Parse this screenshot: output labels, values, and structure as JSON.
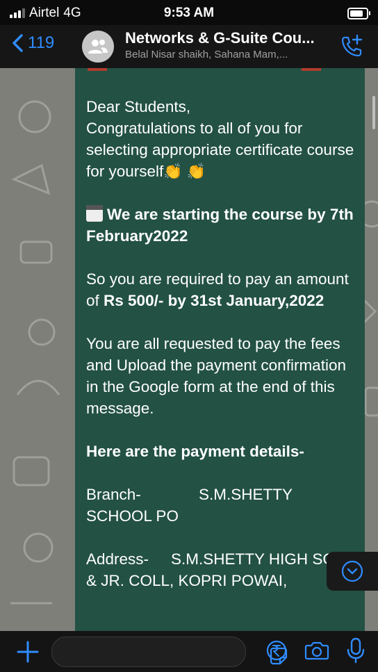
{
  "status_bar": {
    "carrier": "Airtel",
    "network": "4G",
    "time": "9:53 AM"
  },
  "header": {
    "back_count": "119",
    "title": "Networks & G-Suite Cou...",
    "subtitle": "Belal Nisar shaikh, Sahana Mam,..."
  },
  "message": {
    "greeting": "Dear Students,",
    "congrats": "Congratulations to all of you for selecting appropriate certificate course for yourself",
    "start": "We are starting the course by 7th February2022",
    "pay_prefix": "So you are required to pay an amount of ",
    "pay_amount": "Rs 500/- by 31st January,2022",
    "upload": "You are all requested to pay the fees and Upload the payment confirmation in the Google form at the end of this message.",
    "payment_heading": "Here are the payment details-",
    "branch_label": "Branch-",
    "branch_value": "S.M.SHETTY",
    "branch_value2": "SCHOOL PO",
    "address_label": "Address-",
    "address_value": "S.M.SHETTY HIGH SCH",
    "address_value2": "& JR. COLL, KOPRI POWAI,"
  },
  "icons": {
    "back": "chevron-left-icon",
    "group": "group-avatar-icon",
    "call": "add-call-icon",
    "scroll_down": "chevron-down-circle-icon",
    "attach": "plus-icon",
    "sticker": "sticker-icon",
    "payment": "rupee-icon",
    "camera": "camera-icon",
    "mic": "microphone-icon"
  },
  "colors": {
    "accent": "#2f8cff",
    "bubble": "#235144",
    "wallpaper": "#7f7f7a"
  }
}
